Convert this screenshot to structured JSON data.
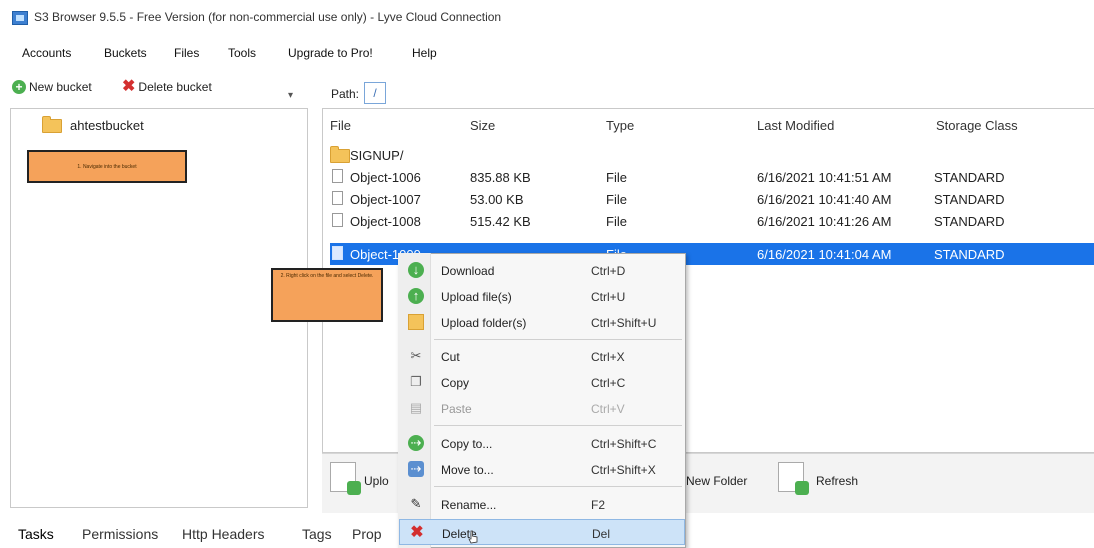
{
  "window": {
    "title": "S3 Browser 9.5.5 - Free Version (for non-commercial use only) - Lyve Cloud Connection"
  },
  "menu": [
    "Accounts",
    "Buckets",
    "Files",
    "Tools",
    "Upgrade to Pro!",
    "Help"
  ],
  "left_toolbar": {
    "new_bucket": "New bucket",
    "delete_bucket": "Delete bucket"
  },
  "bucket_tree": {
    "bucket_name": "ahtestbucket"
  },
  "annotations": {
    "note1": "1. Navigate into the bucket",
    "note2": "2. Right click on the file and select Delete."
  },
  "path": {
    "label": "Path:",
    "value": "/"
  },
  "file_list": {
    "columns": [
      "File",
      "Size",
      "Type",
      "Last Modified",
      "Storage Class"
    ],
    "rows": [
      {
        "name": "SIGNUP/",
        "size": "",
        "type": "",
        "modified": "",
        "class": "",
        "kind": "folder"
      },
      {
        "name": "Object-1006",
        "size": "835.88 KB",
        "type": "File",
        "modified": "6/16/2021 10:41:51 AM",
        "class": "STANDARD",
        "kind": "file"
      },
      {
        "name": "Object-1007",
        "size": "53.00 KB",
        "type": "File",
        "modified": "6/16/2021 10:41:40 AM",
        "class": "STANDARD",
        "kind": "file"
      },
      {
        "name": "Object-1008",
        "size": "515.42 KB",
        "type": "File",
        "modified": "6/16/2021 10:41:26 AM",
        "class": "STANDARD",
        "kind": "file"
      },
      {
        "name": "Object-1009",
        "size": "",
        "type": "File",
        "modified": "6/16/2021 10:41:04 AM",
        "class": "STANDARD",
        "kind": "file",
        "selected": true
      }
    ]
  },
  "bottom_toolbar": {
    "upload": "Uplo",
    "new_folder": "New Folder",
    "refresh": "Refresh"
  },
  "tabs": [
    "Tasks",
    "Permissions",
    "Http Headers",
    "Tags",
    "Prop"
  ],
  "context_menu": {
    "items": [
      {
        "label": "Download",
        "shortcut": "Ctrl+D",
        "icon": "download-icon"
      },
      {
        "label": "Upload file(s)",
        "shortcut": "Ctrl+U",
        "icon": "upload-icon"
      },
      {
        "label": "Upload folder(s)",
        "shortcut": "Ctrl+Shift+U",
        "icon": "upload-folder-icon"
      },
      {
        "label": "Cut",
        "shortcut": "Ctrl+X",
        "icon": "scissors-icon"
      },
      {
        "label": "Copy",
        "shortcut": "Ctrl+C",
        "icon": "copy-icon"
      },
      {
        "label": "Paste",
        "shortcut": "Ctrl+V",
        "icon": "paste-icon",
        "disabled": true
      },
      {
        "label": "Copy to...",
        "shortcut": "Ctrl+Shift+C",
        "icon": "copy-to-icon"
      },
      {
        "label": "Move to...",
        "shortcut": "Ctrl+Shift+X",
        "icon": "move-to-icon"
      },
      {
        "label": "Rename...",
        "shortcut": "F2",
        "icon": "rename-icon"
      },
      {
        "label": "Delete",
        "shortcut": "Del",
        "icon": "delete-icon",
        "hover": true
      }
    ]
  },
  "colors": {
    "selection": "#1a73e8",
    "menu_hover": "#cde3f8",
    "note_fill": "#f5a25a"
  }
}
